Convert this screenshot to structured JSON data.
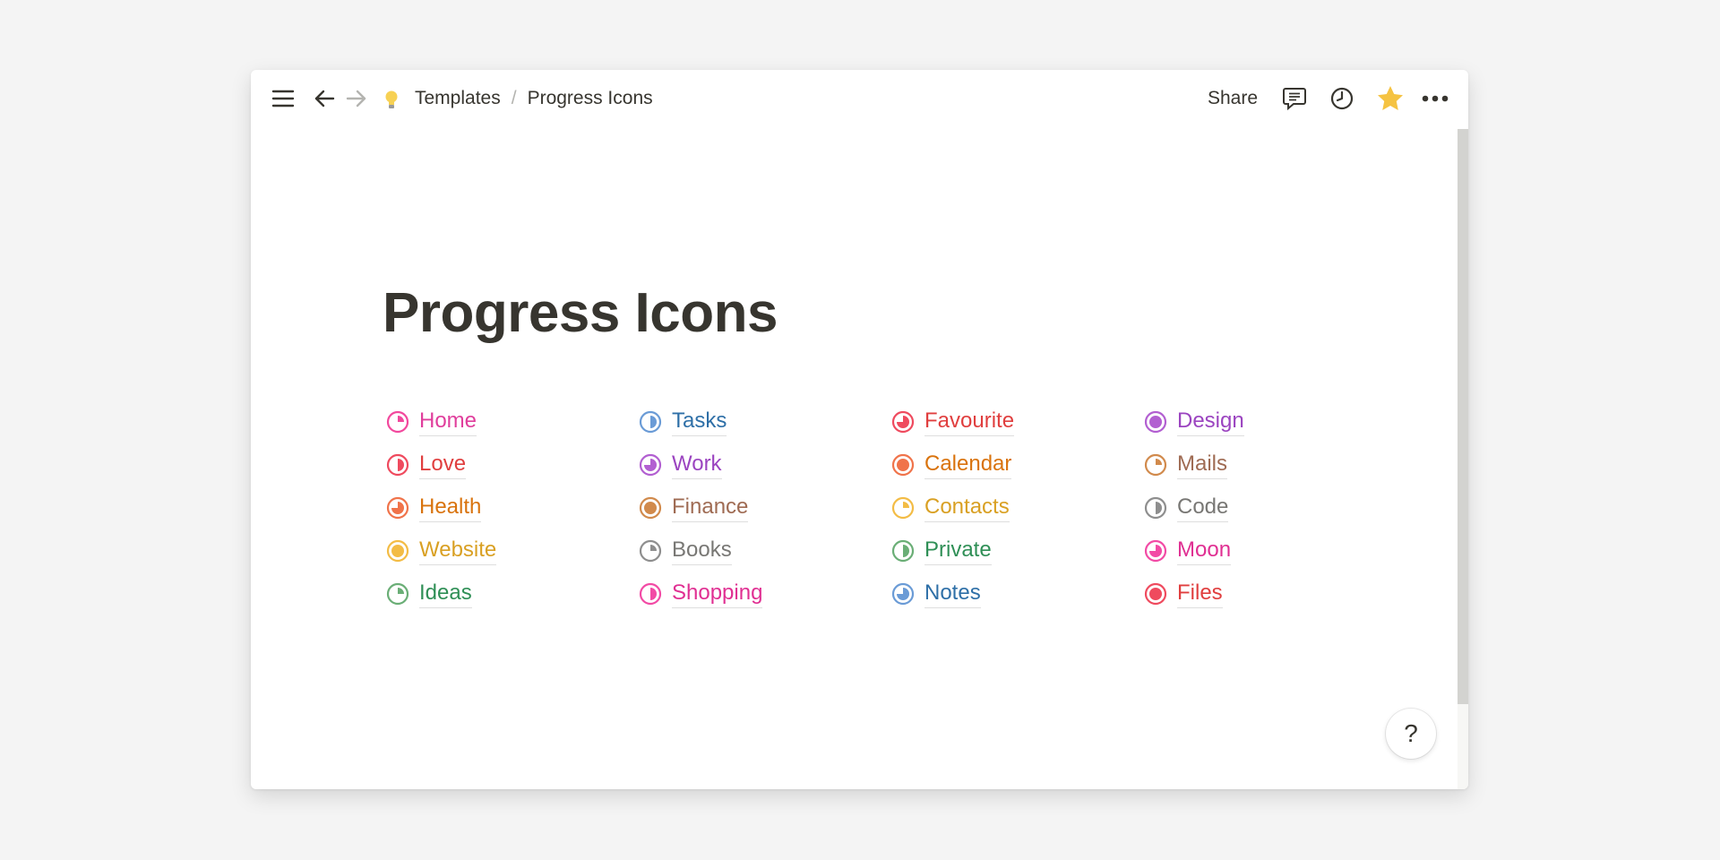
{
  "header": {
    "breadcrumb": [
      "Templates",
      "Progress Icons"
    ],
    "separator": "/",
    "share_label": "Share",
    "icons": [
      "menu-icon",
      "back-arrow-icon",
      "forward-arrow-icon",
      "lightbulb-icon",
      "comment-icon",
      "history-icon",
      "star-icon",
      "more-icon"
    ],
    "star_color": "#f5c342"
  },
  "page": {
    "title": "Progress Icons",
    "columns": [
      [
        {
          "label": "Home",
          "color": "#e03e9c",
          "progress": 0.25
        },
        {
          "label": "Love",
          "color": "#e03e3e",
          "progress": 0.5
        },
        {
          "label": "Health",
          "color": "#d9730d",
          "progress": 0.75
        },
        {
          "label": "Website",
          "color": "#d9a023",
          "progress": 1.0
        },
        {
          "label": "Ideas",
          "color": "#2f8f56",
          "progress": 0.25
        }
      ],
      [
        {
          "label": "Tasks",
          "color": "#2e6fa7",
          "progress": 0.5
        },
        {
          "label": "Work",
          "color": "#9b44c0",
          "progress": 0.75
        },
        {
          "label": "Finance",
          "color": "#9f6b53",
          "progress": 1.0
        },
        {
          "label": "Books",
          "color": "#787774",
          "progress": 0.25
        },
        {
          "label": "Shopping",
          "color": "#e02f92",
          "progress": 0.5
        }
      ],
      [
        {
          "label": "Favourite",
          "color": "#e03e3e",
          "progress": 0.75
        },
        {
          "label": "Calendar",
          "color": "#d9730d",
          "progress": 1.0
        },
        {
          "label": "Contacts",
          "color": "#d9a023",
          "progress": 0.25
        },
        {
          "label": "Private",
          "color": "#2f8f56",
          "progress": 0.5
        },
        {
          "label": "Notes",
          "color": "#2e6fa7",
          "progress": 0.75
        }
      ],
      [
        {
          "label": "Design",
          "color": "#9b44c0",
          "progress": 1.0
        },
        {
          "label": "Mails",
          "color": "#9f6b53",
          "progress": 0.25
        },
        {
          "label": "Code",
          "color": "#787774",
          "progress": 0.5
        },
        {
          "label": "Moon",
          "color": "#e02f92",
          "progress": 0.75
        },
        {
          "label": "Files",
          "color": "#e03e3e",
          "progress": 1.0
        }
      ]
    ],
    "icon_colors": [
      [
        "#f2489d",
        "#ef4a5e",
        "#f0734a",
        "#f3bc45",
        "#6aae76"
      ],
      [
        "#6a9bd6",
        "#b25fd1",
        "#d18a4c",
        "#8e8e8e",
        "#f24aa5"
      ],
      [
        "#ef4a5e",
        "#f0734a",
        "#f3bc45",
        "#6aae76",
        "#6a9bd6"
      ],
      [
        "#b25fd1",
        "#d18a4c",
        "#8e8e8e",
        "#f24aa5",
        "#ef4a5e"
      ]
    ]
  },
  "help_label": "?"
}
